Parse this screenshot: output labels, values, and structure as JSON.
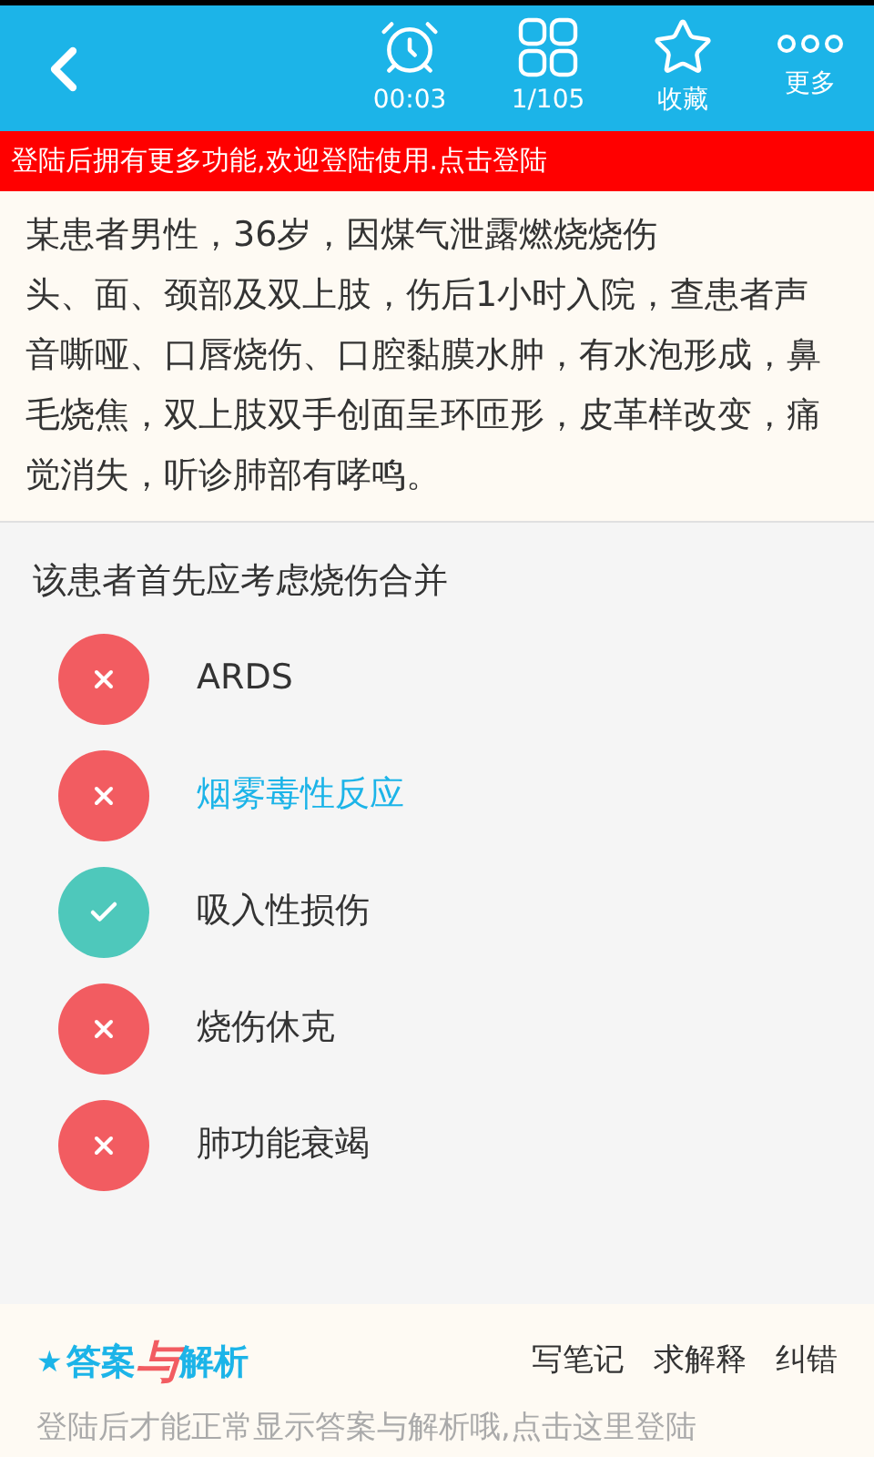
{
  "header": {
    "timer": "00:03",
    "progress": "1/105",
    "favorite": "收藏",
    "more": "更多"
  },
  "login_banner": "登陆后拥有更多功能,欢迎登陆使用.点击登陆",
  "question_lines": [
    "某患者男性，36岁，因煤气泄露燃烧烧伤",
    "头、面、颈部及双上肢，伤后1小时入院，查患者声音嘶哑、口唇烧伤、口腔黏膜水肿，有水泡形成，鼻毛烧焦，双上肢双手创面呈环匝形，皮革样改变，痛觉消失，听诊肺部有哮鸣。"
  ],
  "prompt": "该患者首先应考虑烧伤合并",
  "options": [
    {
      "label": "ARDS",
      "correct": false,
      "selected": false
    },
    {
      "label": "烟雾毒性反应",
      "correct": false,
      "selected": true
    },
    {
      "label": "吸入性损伤",
      "correct": true,
      "selected": false
    },
    {
      "label": "烧伤休克",
      "correct": false,
      "selected": false
    },
    {
      "label": "肺功能衰竭",
      "correct": false,
      "selected": false
    }
  ],
  "answer_panel": {
    "logo": {
      "star": "★",
      "left": "答案",
      "mid": "与",
      "right": "解析"
    },
    "actions": [
      "写笔记",
      "求解释",
      "纠错"
    ],
    "notice": "登陆后才能正常显示答案与解析哦,点击这里登陆"
  }
}
